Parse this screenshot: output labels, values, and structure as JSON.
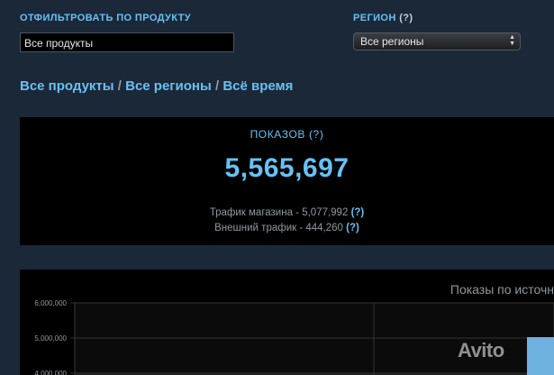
{
  "filters": {
    "product_label": "Отфильтровать по продукту",
    "product_value": "Все продукты",
    "region_label": "Регион",
    "region_help": "(?)",
    "region_value": "Все регионы"
  },
  "breadcrumb": {
    "products": "Все продукты",
    "regions": "Все регионы",
    "time": "Всё время",
    "separator": "/"
  },
  "stats": {
    "title": "ПОКАЗОВ (?)",
    "total": "5,565,697",
    "store_traffic": "Трафик магазина - 5,077,992",
    "external_traffic": "Внешний трафик - 444,260",
    "help": "(?)"
  },
  "chart": {
    "title": "Показы по источн"
  },
  "chart_data": {
    "type": "line",
    "title": "Показы по источн",
    "ylim": [
      4000000,
      6000000
    ],
    "yticks": [
      "6,000,000",
      "5,000,000",
      "4,000,000"
    ],
    "series": []
  },
  "watermark": {
    "text": "Avito",
    "color": "#6fb1e0"
  },
  "colors": {
    "background": "#1b2838",
    "accent": "#67c1f5",
    "panel": "#000000"
  }
}
